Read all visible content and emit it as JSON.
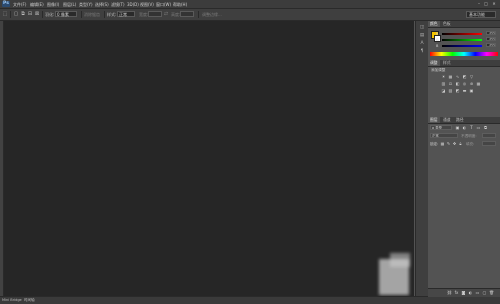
{
  "app": {
    "logo": "Ps"
  },
  "menu": {
    "items": [
      "文件(F)",
      "编辑(E)",
      "图像(I)",
      "图层(L)",
      "类型(Y)",
      "选择(S)",
      "滤镜(T)",
      "3D(D)",
      "视图(V)",
      "窗口(W)",
      "帮助(H)"
    ]
  },
  "window_controls": {
    "minimize": "–",
    "maximize": "□",
    "close": "✕"
  },
  "options_bar": {
    "feather_label": "羽化:",
    "feather_value": "0 像素",
    "antialias_label": "消除锯齿",
    "style_label": "样式:",
    "style_value": "正常",
    "width_label": "宽度:",
    "height_label": "高度:",
    "refine_edge_label": "调整边缘...",
    "workspace_value": "基本功能"
  },
  "status_bar": {
    "doc_info": "Mini Bridge",
    "timeline": "时间轴"
  },
  "panels": {
    "color_tabs": [
      "颜色",
      "色板"
    ],
    "sliders": [
      {
        "label": "R",
        "value": "255",
        "gradient": "linear-gradient(90deg,#000,#ff0000)"
      },
      {
        "label": "G",
        "value": "255",
        "gradient": "linear-gradient(90deg,#000,#00ff00)"
      },
      {
        "label": "B",
        "value": "255",
        "gradient": "linear-gradient(90deg,#000,#0000ff)"
      }
    ],
    "adjust_tabs": [
      "调整",
      "样式"
    ],
    "adjust_title": "添加调整",
    "layer_tabs": [
      "图层",
      "通道",
      "路径"
    ],
    "layer_kind": "ρ 类型",
    "blend_mode": "正常",
    "opacity_label": "不透明度:",
    "lock_label": "锁定:",
    "fill_label": "填充:"
  },
  "colors": {
    "canvas": "#262626",
    "ui_bg": "#535353",
    "foreground": "#f5c400",
    "background": "#ffffff"
  }
}
